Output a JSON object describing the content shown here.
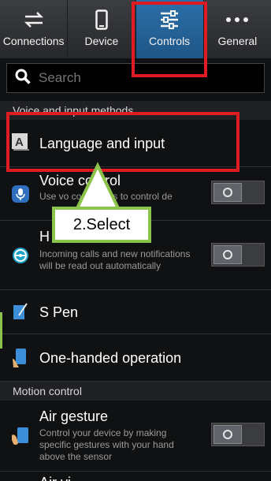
{
  "tabs": [
    {
      "label": "Connections",
      "icon": "swap-arrows-icon"
    },
    {
      "label": "Device",
      "icon": "phone-icon"
    },
    {
      "label": "Controls",
      "icon": "sliders-icon",
      "active": true
    },
    {
      "label": "General",
      "icon": "more-dots-icon"
    }
  ],
  "search": {
    "placeholder": "Search"
  },
  "sections": {
    "voice": "Voice and input methods",
    "motion": "Motion control"
  },
  "rows": {
    "language": {
      "title": "Language and input"
    },
    "voice_control": {
      "title": "Voice control",
      "subtitle": "Use vo commands to control de"
    },
    "h": {
      "title": "H",
      "subtitle": "Incoming calls and new notifications will be read out automatically"
    },
    "spen": {
      "title": "S Pen"
    },
    "onehanded": {
      "title": "One-handed operation"
    },
    "air_gesture": {
      "title": "Air gesture",
      "subtitle": "Control your device by making specific gestures with your hand above the sensor"
    },
    "air_view": {
      "title": "Air vi"
    }
  },
  "callout": {
    "text": "2.Select"
  },
  "colors": {
    "highlight": "#e01b24",
    "callout_border": "#8cc34a",
    "active_tab": "#2b6fa8"
  }
}
